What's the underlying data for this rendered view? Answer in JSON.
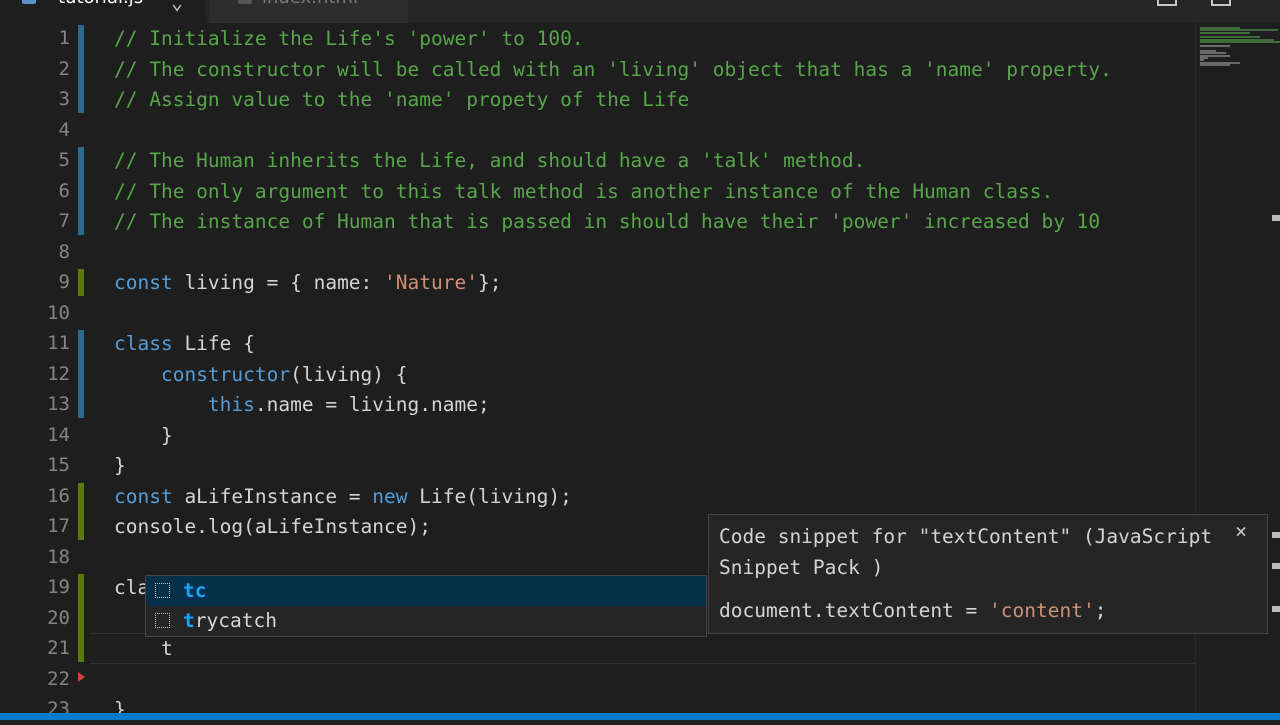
{
  "tabs": [
    {
      "label": "tutorial.js",
      "active": true
    },
    {
      "label": "index.html",
      "active": false
    }
  ],
  "editor": {
    "lines": [
      {
        "n": "1",
        "tokens": [
          {
            "t": "// Initialize the Life's 'power' to 100.",
            "c": "c-comment"
          }
        ]
      },
      {
        "n": "2",
        "tokens": [
          {
            "t": "// The constructor will be called with an 'living' object that has a 'name' property.",
            "c": "c-comment"
          }
        ]
      },
      {
        "n": "3",
        "tokens": [
          {
            "t": "// Assign value to the 'name' propety of the Life",
            "c": "c-comment"
          }
        ]
      },
      {
        "n": "4",
        "tokens": []
      },
      {
        "n": "5",
        "tokens": [
          {
            "t": "// The Human inherits the Life, and should have a 'talk' method.",
            "c": "c-comment"
          }
        ]
      },
      {
        "n": "6",
        "tokens": [
          {
            "t": "// The only argument to this talk method is another instance of the Human class.",
            "c": "c-comment"
          }
        ]
      },
      {
        "n": "7",
        "tokens": [
          {
            "t": "// The instance of Human that is passed in should have their 'power' increased by 10",
            "c": "c-comment"
          }
        ]
      },
      {
        "n": "8",
        "tokens": []
      },
      {
        "n": "9",
        "tokens": [
          {
            "t": "const",
            "c": "c-kw"
          },
          {
            "t": " living = { name: ",
            "c": "c-plain"
          },
          {
            "t": "'Nature'",
            "c": "c-str"
          },
          {
            "t": "};",
            "c": "c-plain"
          }
        ]
      },
      {
        "n": "10",
        "tokens": []
      },
      {
        "n": "11",
        "tokens": [
          {
            "t": "class",
            "c": "c-kw"
          },
          {
            "t": " Life {",
            "c": "c-plain"
          }
        ]
      },
      {
        "n": "12",
        "tokens": [
          {
            "t": "    ",
            "c": "c-plain"
          },
          {
            "t": "constructor",
            "c": "c-kw"
          },
          {
            "t": "(living) {",
            "c": "c-plain"
          }
        ]
      },
      {
        "n": "13",
        "tokens": [
          {
            "t": "        ",
            "c": "c-plain"
          },
          {
            "t": "this",
            "c": "c-kw"
          },
          {
            "t": ".name = living.name;",
            "c": "c-plain"
          }
        ]
      },
      {
        "n": "14",
        "tokens": [
          {
            "t": "    }",
            "c": "c-plain"
          }
        ]
      },
      {
        "n": "15",
        "tokens": [
          {
            "t": "}",
            "c": "c-plain"
          }
        ]
      },
      {
        "n": "16",
        "tokens": [
          {
            "t": "const",
            "c": "c-kw"
          },
          {
            "t": " aLifeInstance = ",
            "c": "c-plain"
          },
          {
            "t": "new",
            "c": "c-kw"
          },
          {
            "t": " Life(living);",
            "c": "c-plain"
          }
        ]
      },
      {
        "n": "17",
        "tokens": [
          {
            "t": "console.log(aLifeInstance);",
            "c": "c-plain"
          }
        ]
      },
      {
        "n": "18",
        "tokens": []
      },
      {
        "n": "19",
        "tokens": [
          {
            "t": "cla",
            "c": "c-plain"
          }
        ]
      },
      {
        "n": "20",
        "tokens": []
      },
      {
        "n": "21",
        "tokens": [
          {
            "t": "    t",
            "c": "c-plain"
          }
        ]
      },
      {
        "n": "22",
        "tokens": []
      },
      {
        "n": "23",
        "tokens": [
          {
            "t": "}",
            "c": "c-plain"
          }
        ]
      }
    ]
  },
  "suggest": {
    "items": [
      {
        "label": "tc",
        "selected": true
      },
      {
        "label": "trycatch",
        "selected": false
      }
    ]
  },
  "details": {
    "description": "Code snippet for \"textContent\" (JavaScript Snippet Pack )",
    "close_glyph": "×",
    "code": [
      {
        "t": "document.textContent = ",
        "c": "c-plain"
      },
      {
        "t": "'content'",
        "c": "c-str"
      },
      {
        "t": ";",
        "c": "c-plain"
      }
    ]
  },
  "colors": {
    "background": "#1e1e1e",
    "comment": "#57a64a",
    "keyword": "#569cd6",
    "string": "#ce9178",
    "suggest_selected": "#062f4a",
    "suggest_match": "#18a3ff",
    "statusbar": "#007acc"
  }
}
